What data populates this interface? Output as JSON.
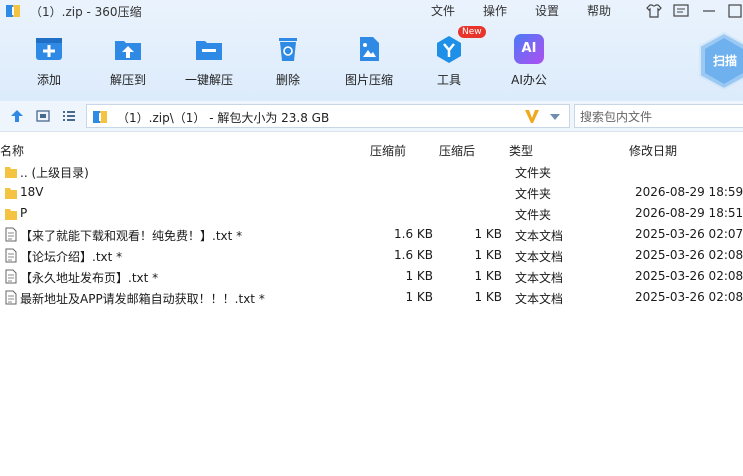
{
  "window": {
    "title": "（1）.zip - 360压缩"
  },
  "menu": [
    "文件",
    "操作",
    "设置",
    "帮助"
  ],
  "toolbar": [
    {
      "label": "添加",
      "icon": "add-icon"
    },
    {
      "label": "解压到",
      "icon": "extract-to-icon"
    },
    {
      "label": "一键解压",
      "icon": "one-click-extract-icon"
    },
    {
      "label": "删除",
      "icon": "delete-icon"
    },
    {
      "label": "图片压缩",
      "icon": "image-compress-icon"
    },
    {
      "label": "工具",
      "icon": "tools-icon",
      "badge": "New"
    },
    {
      "label": "AI办公",
      "icon": "ai-office-icon",
      "icon_text": "AI"
    }
  ],
  "scan": {
    "label": "扫描"
  },
  "address": {
    "path": "（1）.zip\\（1） - 解包大小为 23.8 GB"
  },
  "search": {
    "placeholder": "搜索包内文件"
  },
  "columns": {
    "name": "名称",
    "packed": "压缩前",
    "size": "压缩后",
    "type": "类型",
    "modified": "修改日期"
  },
  "files": [
    {
      "name": ".. (上级目录)",
      "packed": "",
      "size": "",
      "type": "文件夹",
      "modified": "",
      "kind": "folder"
    },
    {
      "name": "18V",
      "packed": "",
      "size": "",
      "type": "文件夹",
      "modified": "2026-08-29 18:59",
      "kind": "folder"
    },
    {
      "name": "P",
      "packed": "",
      "size": "",
      "type": "文件夹",
      "modified": "2026-08-29 18:51",
      "kind": "folder"
    },
    {
      "name": "【来了就能下载和观看！纯免费！】.txt *",
      "packed": "1.6 KB",
      "size": "1 KB",
      "type": "文本文档",
      "modified": "2025-03-26 02:07",
      "kind": "file"
    },
    {
      "name": "【论坛介绍】.txt *",
      "packed": "1.6 KB",
      "size": "1 KB",
      "type": "文本文档",
      "modified": "2025-03-26 02:08",
      "kind": "file"
    },
    {
      "name": "【永久地址发布页】.txt *",
      "packed": "1 KB",
      "size": "1 KB",
      "type": "文本文档",
      "modified": "2025-03-26 02:08",
      "kind": "file"
    },
    {
      "name": "最新地址及APP请发邮箱自动获取！！！.txt *",
      "packed": "1 KB",
      "size": "1 KB",
      "type": "文本文档",
      "modified": "2025-03-26 02:08",
      "kind": "file"
    }
  ],
  "colors": {
    "accent": "#2f8ae6",
    "folder": "#f5c342",
    "badge": "#e8342b",
    "vlogo": "#f0a81e"
  }
}
